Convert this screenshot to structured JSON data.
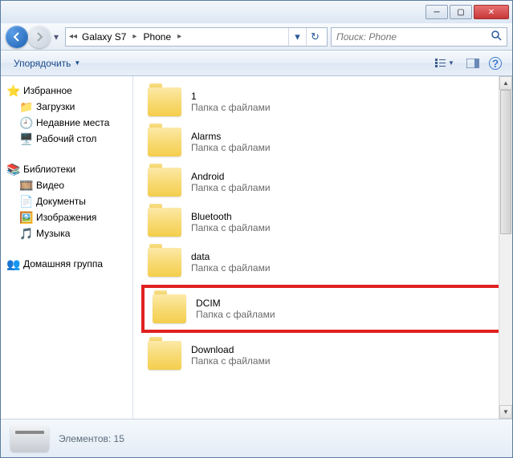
{
  "titlebar": {
    "minimize": "─",
    "maximize": "▢",
    "close": "✕"
  },
  "breadcrumb": {
    "segments": [
      "Galaxy S7",
      "Phone"
    ]
  },
  "search": {
    "placeholder": "Поиск: Phone"
  },
  "toolbar": {
    "organize": "Упорядочить"
  },
  "sidebar": {
    "favorites": {
      "label": "Избранное",
      "items": [
        "Загрузки",
        "Недавние места",
        "Рабочий стол"
      ]
    },
    "libraries": {
      "label": "Библиотеки",
      "items": [
        "Видео",
        "Документы",
        "Изображения",
        "Музыка"
      ]
    },
    "homegroup": {
      "label": "Домашняя группа"
    }
  },
  "folders": {
    "type_label": "Папка с файлами",
    "items": [
      {
        "name": "1",
        "highlighted": false
      },
      {
        "name": "Alarms",
        "highlighted": false
      },
      {
        "name": "Android",
        "highlighted": false
      },
      {
        "name": "Bluetooth",
        "highlighted": false
      },
      {
        "name": "data",
        "highlighted": false
      },
      {
        "name": "DCIM",
        "highlighted": true
      },
      {
        "name": "Download",
        "highlighted": false
      }
    ]
  },
  "statusbar": {
    "text": "Элементов: 15"
  }
}
